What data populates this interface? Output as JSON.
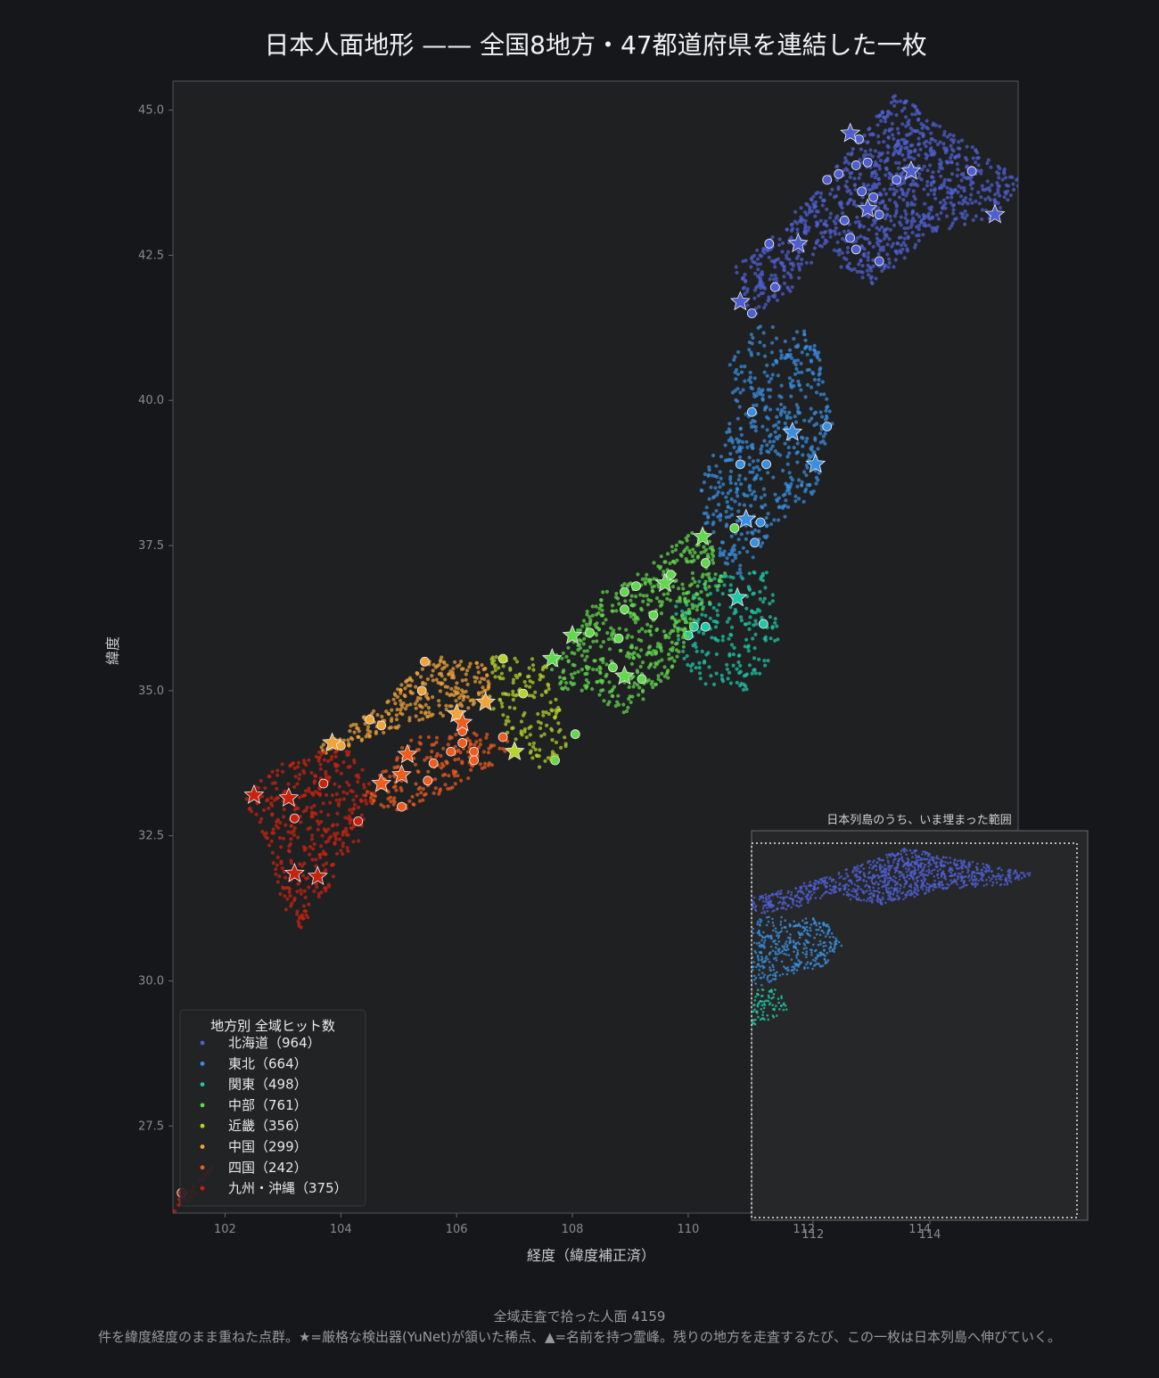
{
  "title": "日本人面地形 —— 全国8地方・47都道府県を連結した一枚",
  "caption": {
    "line1": "全域走査で拾った人面 4159",
    "line2": "件を緯度経度のまま重ねた点群。★=厳格な検出器(YuNet)が頷いた稀点、▲=名前を持つ霊峰。残りの地方を走査するたび、この一枚は日本列島へ伸びていく。"
  },
  "chart_data": [
    {
      "type": "scatter",
      "title": "日本人面地形 —— 全国8地方・47都道府県を連結した一枚",
      "xlabel": "経度（緯度補正済）",
      "ylabel": "緯度",
      "xlim": [
        101.1,
        115.7
      ],
      "ylim": [
        26.0,
        45.5
      ],
      "xticks": [
        102,
        104,
        106,
        108,
        110,
        112,
        114
      ],
      "yticks": [
        27.5,
        30.0,
        32.5,
        35.0,
        37.5,
        40.0,
        42.5,
        45.0
      ],
      "grid": false,
      "legend": {
        "title": "地方別 全域ヒット数",
        "placement": "lower-left",
        "entries": [
          {
            "label": "北海道（964）",
            "color": "#4f5fd0"
          },
          {
            "label": "東北（664）",
            "color": "#3a8fe0"
          },
          {
            "label": "関東（498）",
            "color": "#20c7a8"
          },
          {
            "label": "中部（761）",
            "color": "#63d84e"
          },
          {
            "label": "近畿（356）",
            "color": "#b9d32c"
          },
          {
            "label": "中国（299）",
            "color": "#f0a43a"
          },
          {
            "label": "四国（242）",
            "color": "#ee5c1e"
          },
          {
            "label": "九州・沖縄（375）",
            "color": "#c8230f"
          }
        ]
      },
      "series": [
        {
          "name": "北海道（964）",
          "color": "#4f5fd0",
          "hulls": [
            {
              "x": [
                110.8,
                111.5,
                112.3,
                113.0,
                113.6,
                115.0,
                115.8,
                115.3,
                114.2,
                113.6,
                113.2,
                112.6,
                112.4,
                111.8,
                111.1
              ],
              "y": [
                42.3,
                42.9,
                43.7,
                44.6,
                45.3,
                44.3,
                43.8,
                43.1,
                42.9,
                42.3,
                42.0,
                42.3,
                42.7,
                41.9,
                41.4
              ]
            }
          ],
          "highlights": [
            [
              112.4,
              43.8
            ],
            [
              112.6,
              43.9
            ],
            [
              112.9,
              44.05
            ],
            [
              113.1,
              44.1
            ],
            [
              113.0,
              43.6
            ],
            [
              113.2,
              43.5
            ],
            [
              113.3,
              43.2
            ],
            [
              112.7,
              43.1
            ],
            [
              112.8,
              42.8
            ],
            [
              112.9,
              42.6
            ],
            [
              113.3,
              42.4
            ],
            [
              113.6,
              43.8
            ],
            [
              114.9,
              43.95
            ],
            [
              112.95,
              44.5
            ],
            [
              111.4,
              42.7
            ],
            [
              111.5,
              41.95
            ],
            [
              111.1,
              41.5
            ]
          ],
          "stars": [
            [
              112.8,
              44.6
            ],
            [
              113.85,
              43.95
            ],
            [
              113.1,
              43.3
            ],
            [
              115.3,
              43.2
            ],
            [
              111.9,
              42.7
            ],
            [
              110.9,
              41.7
            ]
          ]
        },
        {
          "name": "東北（664）",
          "color": "#3a8fe0",
          "hulls": [
            {
              "x": [
                110.7,
                111.2,
                112.2,
                112.5,
                112.2,
                111.4,
                111.0,
                110.6,
                110.3,
                110.2,
                110.8
              ],
              "y": [
                40.7,
                41.3,
                41.2,
                39.6,
                38.4,
                37.6,
                36.9,
                37.2,
                37.8,
                38.6,
                39.8
              ]
            }
          ],
          "highlights": [
            [
              111.1,
              39.8
            ],
            [
              112.4,
              39.55
            ],
            [
              110.9,
              38.9
            ],
            [
              111.35,
              38.9
            ],
            [
              111.25,
              37.9
            ],
            [
              110.8,
              37.8
            ],
            [
              111.15,
              37.55
            ]
          ],
          "stars": [
            [
              111.8,
              39.45
            ],
            [
              112.2,
              38.9
            ],
            [
              111.0,
              37.95
            ]
          ]
        },
        {
          "name": "関東（498）",
          "color": "#20c7a8",
          "hulls": [
            {
              "x": [
                110.2,
                111.4,
                111.6,
                111.0,
                110.3,
                109.9,
                109.7
              ],
              "y": [
                37.0,
                37.1,
                35.7,
                35.0,
                35.1,
                35.5,
                36.4
              ]
            }
          ],
          "highlights": [
            [
              110.1,
              36.1
            ],
            [
              111.3,
              36.15
            ],
            [
              110.3,
              36.1
            ],
            [
              110.0,
              35.95
            ]
          ],
          "stars": [
            [
              110.85,
              36.6
            ]
          ]
        },
        {
          "name": "中部（761）",
          "color": "#63d84e",
          "hulls": [
            {
              "x": [
                107.7,
                108.5,
                109.4,
                110.2,
                110.7,
                110.1,
                109.6,
                108.9,
                108.3,
                107.8,
                107.6
              ],
              "y": [
                35.6,
                36.7,
                37.2,
                37.9,
                37.0,
                36.1,
                35.1,
                34.6,
                34.9,
                35.0,
                35.3
              ]
            }
          ],
          "highlights": [
            [
              108.9,
              36.7
            ],
            [
              109.1,
              36.8
            ],
            [
              109.7,
              37.0
            ],
            [
              110.3,
              37.2
            ],
            [
              108.9,
              36.4
            ],
            [
              109.4,
              36.3
            ],
            [
              108.8,
              35.9
            ],
            [
              108.3,
              36.0
            ],
            [
              108.7,
              35.4
            ],
            [
              109.2,
              35.2
            ],
            [
              110.8,
              37.8
            ],
            [
              108.05,
              34.25
            ],
            [
              107.7,
              33.8
            ]
          ],
          "stars": [
            [
              110.25,
              37.65
            ],
            [
              109.6,
              36.85
            ],
            [
              108.0,
              35.95
            ],
            [
              107.65,
              35.55
            ],
            [
              108.9,
              35.25
            ]
          ]
        },
        {
          "name": "近畿（356）",
          "color": "#b9d32c",
          "hulls": [
            {
              "x": [
                106.6,
                107.4,
                107.8,
                107.9,
                107.4,
                106.9,
                106.5
              ],
              "y": [
                35.6,
                35.6,
                35.1,
                34.0,
                33.6,
                34.2,
                34.9
              ]
            }
          ],
          "highlights": [
            [
              107.15,
              34.95
            ],
            [
              106.8,
              35.55
            ]
          ],
          "stars": [
            [
              107.0,
              33.95
            ]
          ]
        },
        {
          "name": "中国（299）",
          "color": "#f0a43a",
          "hulls": [
            {
              "x": [
                103.6,
                104.6,
                105.6,
                106.5,
                106.6,
                106.0,
                105.1,
                104.3,
                103.7
              ],
              "y": [
                34.0,
                34.7,
                35.6,
                35.5,
                34.9,
                34.6,
                34.4,
                34.1,
                33.9
              ]
            }
          ],
          "highlights": [
            [
              105.45,
              35.5
            ],
            [
              105.4,
              35.0
            ],
            [
              104.5,
              34.5
            ],
            [
              104.7,
              34.4
            ],
            [
              104.0,
              34.05
            ]
          ],
          "stars": [
            [
              106.0,
              34.6
            ],
            [
              106.5,
              34.8
            ],
            [
              103.85,
              34.1
            ]
          ]
        },
        {
          "name": "四国（242）",
          "color": "#ee5c1e",
          "hulls": [
            {
              "x": [
                104.4,
                105.2,
                106.4,
                107.0,
                106.6,
                105.8,
                105.0,
                104.6
              ],
              "y": [
                33.2,
                34.2,
                34.3,
                34.1,
                33.7,
                33.2,
                32.9,
                33.0
              ]
            }
          ],
          "highlights": [
            [
              106.1,
              34.3
            ],
            [
              106.1,
              34.1
            ],
            [
              105.9,
              33.95
            ],
            [
              106.3,
              33.95
            ],
            [
              106.3,
              33.8
            ],
            [
              105.6,
              33.75
            ],
            [
              105.5,
              33.45
            ],
            [
              105.05,
              33.0
            ],
            [
              106.8,
              34.2
            ]
          ],
          "stars": [
            [
              105.15,
              33.9
            ],
            [
              104.7,
              33.4
            ],
            [
              105.05,
              33.55
            ],
            [
              106.1,
              34.45
            ]
          ]
        },
        {
          "name": "九州・沖縄（375）",
          "color": "#c8230f",
          "hulls": [
            {
              "x": [
                102.3,
                103.2,
                104.2,
                104.6,
                104.3,
                103.7,
                103.3,
                103.0,
                102.8
              ],
              "y": [
                33.2,
                33.9,
                34.0,
                33.2,
                32.4,
                31.4,
                30.9,
                31.2,
                32.2
              ]
            },
            {
              "x": [
                101.1,
                101.4,
                101.8,
                101.5,
                101.1
              ],
              "y": [
                26.1,
                26.5,
                26.8,
                26.3,
                26.0
              ]
            }
          ],
          "highlights": [
            [
              103.7,
              33.4
            ],
            [
              103.2,
              32.8
            ],
            [
              104.3,
              32.75
            ],
            [
              101.25,
              26.35
            ]
          ],
          "stars": [
            [
              102.5,
              33.2
            ],
            [
              103.1,
              33.15
            ],
            [
              103.2,
              31.85
            ],
            [
              103.6,
              31.8
            ]
          ]
        }
      ]
    },
    {
      "type": "scatter",
      "title": "日本列島のうち、いま埋まった範囲",
      "xlim": [
        110.95,
        116.7
      ],
      "ylim": [
        23.6,
        46.3
      ],
      "xticks": [
        112,
        114
      ],
      "note": "inset showing the same point cloud over the whole archipelago"
    }
  ]
}
